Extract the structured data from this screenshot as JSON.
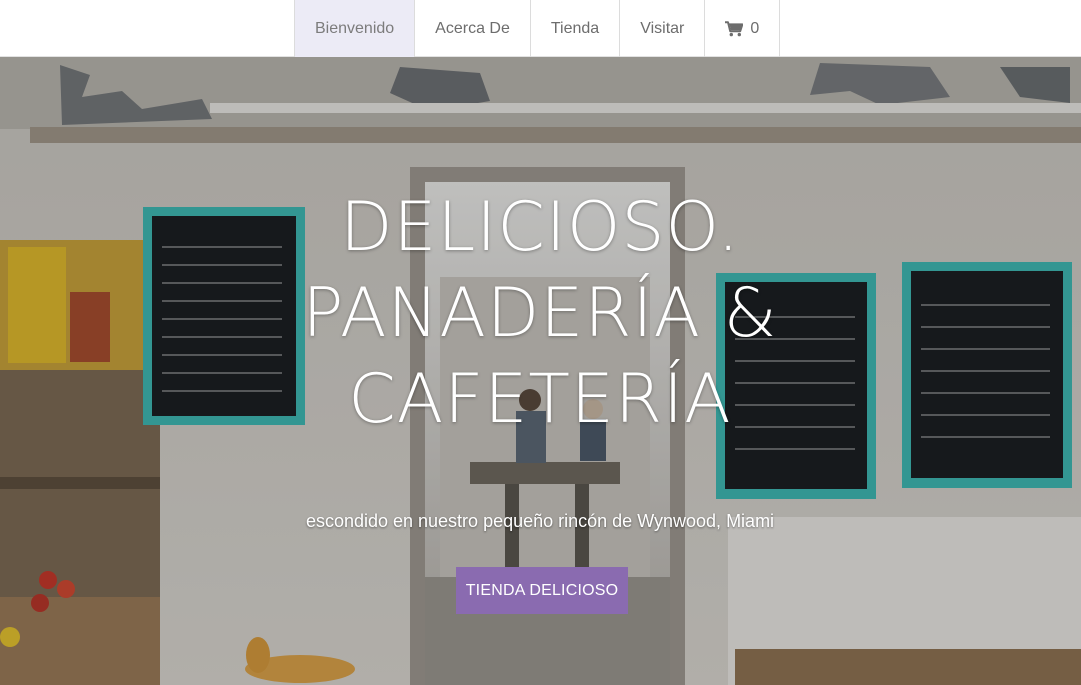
{
  "nav": {
    "items": [
      {
        "label": "Bienvenido",
        "active": true
      },
      {
        "label": "Acerca De"
      },
      {
        "label": "Tienda"
      },
      {
        "label": "Visitar"
      }
    ],
    "cart": {
      "icon": "shopping-cart-icon",
      "count": "0"
    }
  },
  "hero": {
    "title_lines": [
      "DELICIOSO.",
      "PANADERÍA &",
      "CAFETERÍA"
    ],
    "subtitle": "escondido en nuestro pequeño rincón de Wynwood, Miami",
    "cta_label": "TIENDA DELICIOSO"
  },
  "colors": {
    "accent": "#8a6bb0",
    "nav_active_bg": "#ecebf6",
    "chalkboard_frame": "#3fb8b2"
  }
}
